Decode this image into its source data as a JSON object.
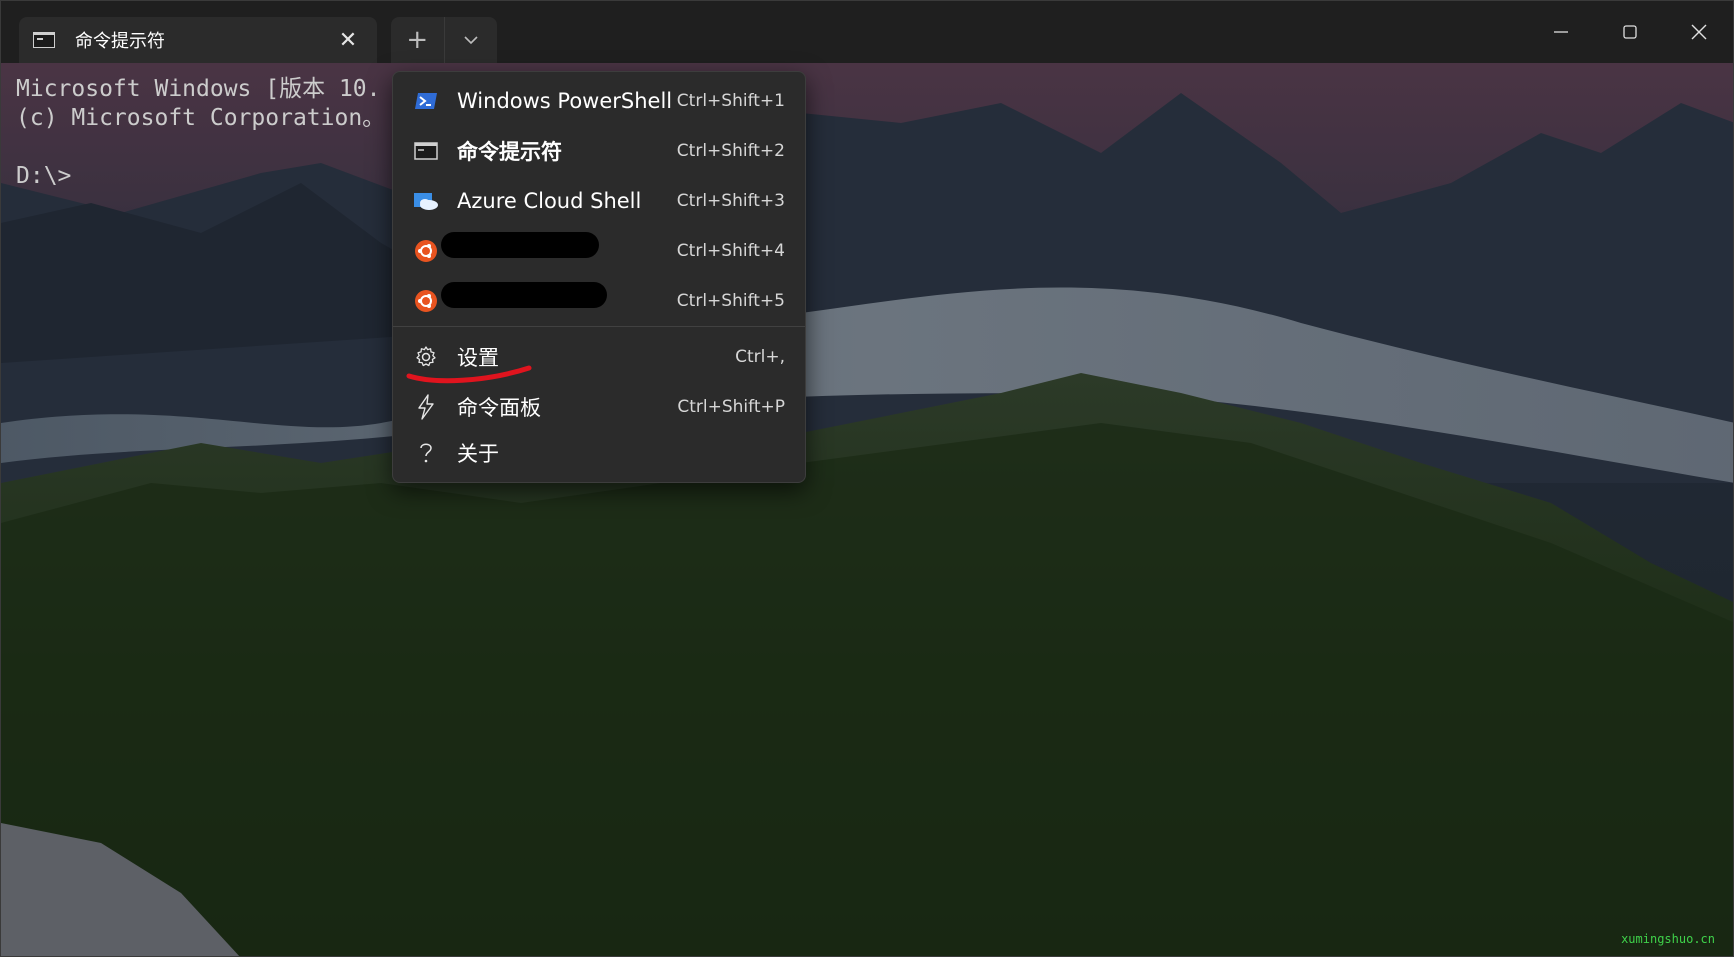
{
  "tab": {
    "title": "命令提示符",
    "close_glyph": "✕"
  },
  "tab_actions": {
    "new_tab_glyph": "+",
    "dropdown_glyph": "⌄"
  },
  "terminal": {
    "lines": [
      "Microsoft Windows [版本 10.",
      "(c) Microsoft Corporation。",
      "",
      "D:\\>"
    ]
  },
  "menu": {
    "items": [
      {
        "label": "Windows PowerShell",
        "shortcut": "Ctrl+Shift+1",
        "icon": "powershell-icon"
      },
      {
        "label": "命令提示符",
        "shortcut": "Ctrl+Shift+2",
        "icon": "cmd-icon"
      },
      {
        "label": "Azure Cloud Shell",
        "shortcut": "Ctrl+Shift+3",
        "icon": "azure-cloud-icon"
      },
      {
        "label": "",
        "shortcut": "Ctrl+Shift+4",
        "icon": "ubuntu-icon"
      },
      {
        "label": "",
        "shortcut": "Ctrl+Shift+5",
        "icon": "ubuntu-icon"
      },
      {
        "label": "设置",
        "shortcut": "Ctrl+,",
        "icon": "gear-icon"
      },
      {
        "label": "命令面板",
        "shortcut": "Ctrl+Shift+P",
        "icon": "lightning-icon"
      },
      {
        "label": "关于",
        "shortcut": "",
        "icon": "question-icon"
      }
    ]
  },
  "watermark": "xumingshuo.cn",
  "colors": {
    "menu_bg": "#2b2b2b",
    "titlebar_bg": "#1f1f1f",
    "annotation_red": "#e0141e",
    "ubuntu_orange": "#e95420",
    "watermark_green": "#3fd14a"
  }
}
